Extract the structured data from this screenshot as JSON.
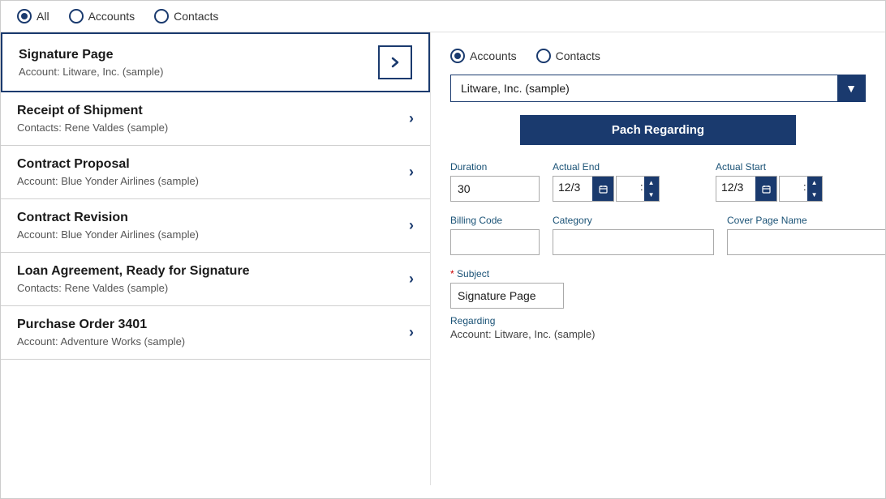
{
  "top_bar": {
    "options": [
      {
        "id": "all",
        "label": "All",
        "selected": true
      },
      {
        "id": "accounts",
        "label": "Accounts",
        "selected": false
      },
      {
        "id": "contacts",
        "label": "Contacts",
        "selected": false
      }
    ]
  },
  "list": {
    "items": [
      {
        "title": "Signature Page",
        "subtitle": "Account: Litware, Inc. (sample)",
        "active": true
      },
      {
        "title": "Receipt of Shipment",
        "subtitle": "Contacts: Rene Valdes (sample)",
        "active": false
      },
      {
        "title": "Contract Proposal",
        "subtitle": "Account: Blue Yonder Airlines (sample)",
        "active": false
      },
      {
        "title": "Contract Revision",
        "subtitle": "Account: Blue Yonder Airlines (sample)",
        "active": false
      },
      {
        "title": "Loan Agreement, Ready for Signature",
        "subtitle": "Contacts: Rene Valdes (sample)",
        "active": false
      },
      {
        "title": "Purchase Order 3401",
        "subtitle": "Account: Adventure Works (sample)",
        "active": false
      }
    ]
  },
  "right_panel": {
    "radio_options": [
      {
        "id": "accounts",
        "label": "Accounts",
        "selected": true
      },
      {
        "id": "contacts",
        "label": "Contacts",
        "selected": false
      }
    ],
    "dropdown": {
      "value": "Litware, Inc. (sample)"
    },
    "patch_button_label": "Pach Regarding",
    "form": {
      "duration_label": "Duration",
      "duration_value": "30",
      "actual_end_label": "Actual End",
      "actual_end_date": "12/3",
      "actual_end_time": "",
      "actual_start_label": "Actual Start",
      "actual_start_date": "12/3",
      "actual_start_time": "",
      "billing_code_label": "Billing Code",
      "billing_code_value": "",
      "category_label": "Category",
      "category_value": "",
      "cover_page_label": "Cover Page Name",
      "cover_page_value": "",
      "subject_label": "Subject",
      "subject_value": "Signature Page",
      "regarding_label": "Regarding",
      "regarding_value": "Account: Litware, Inc. (sample)"
    }
  }
}
